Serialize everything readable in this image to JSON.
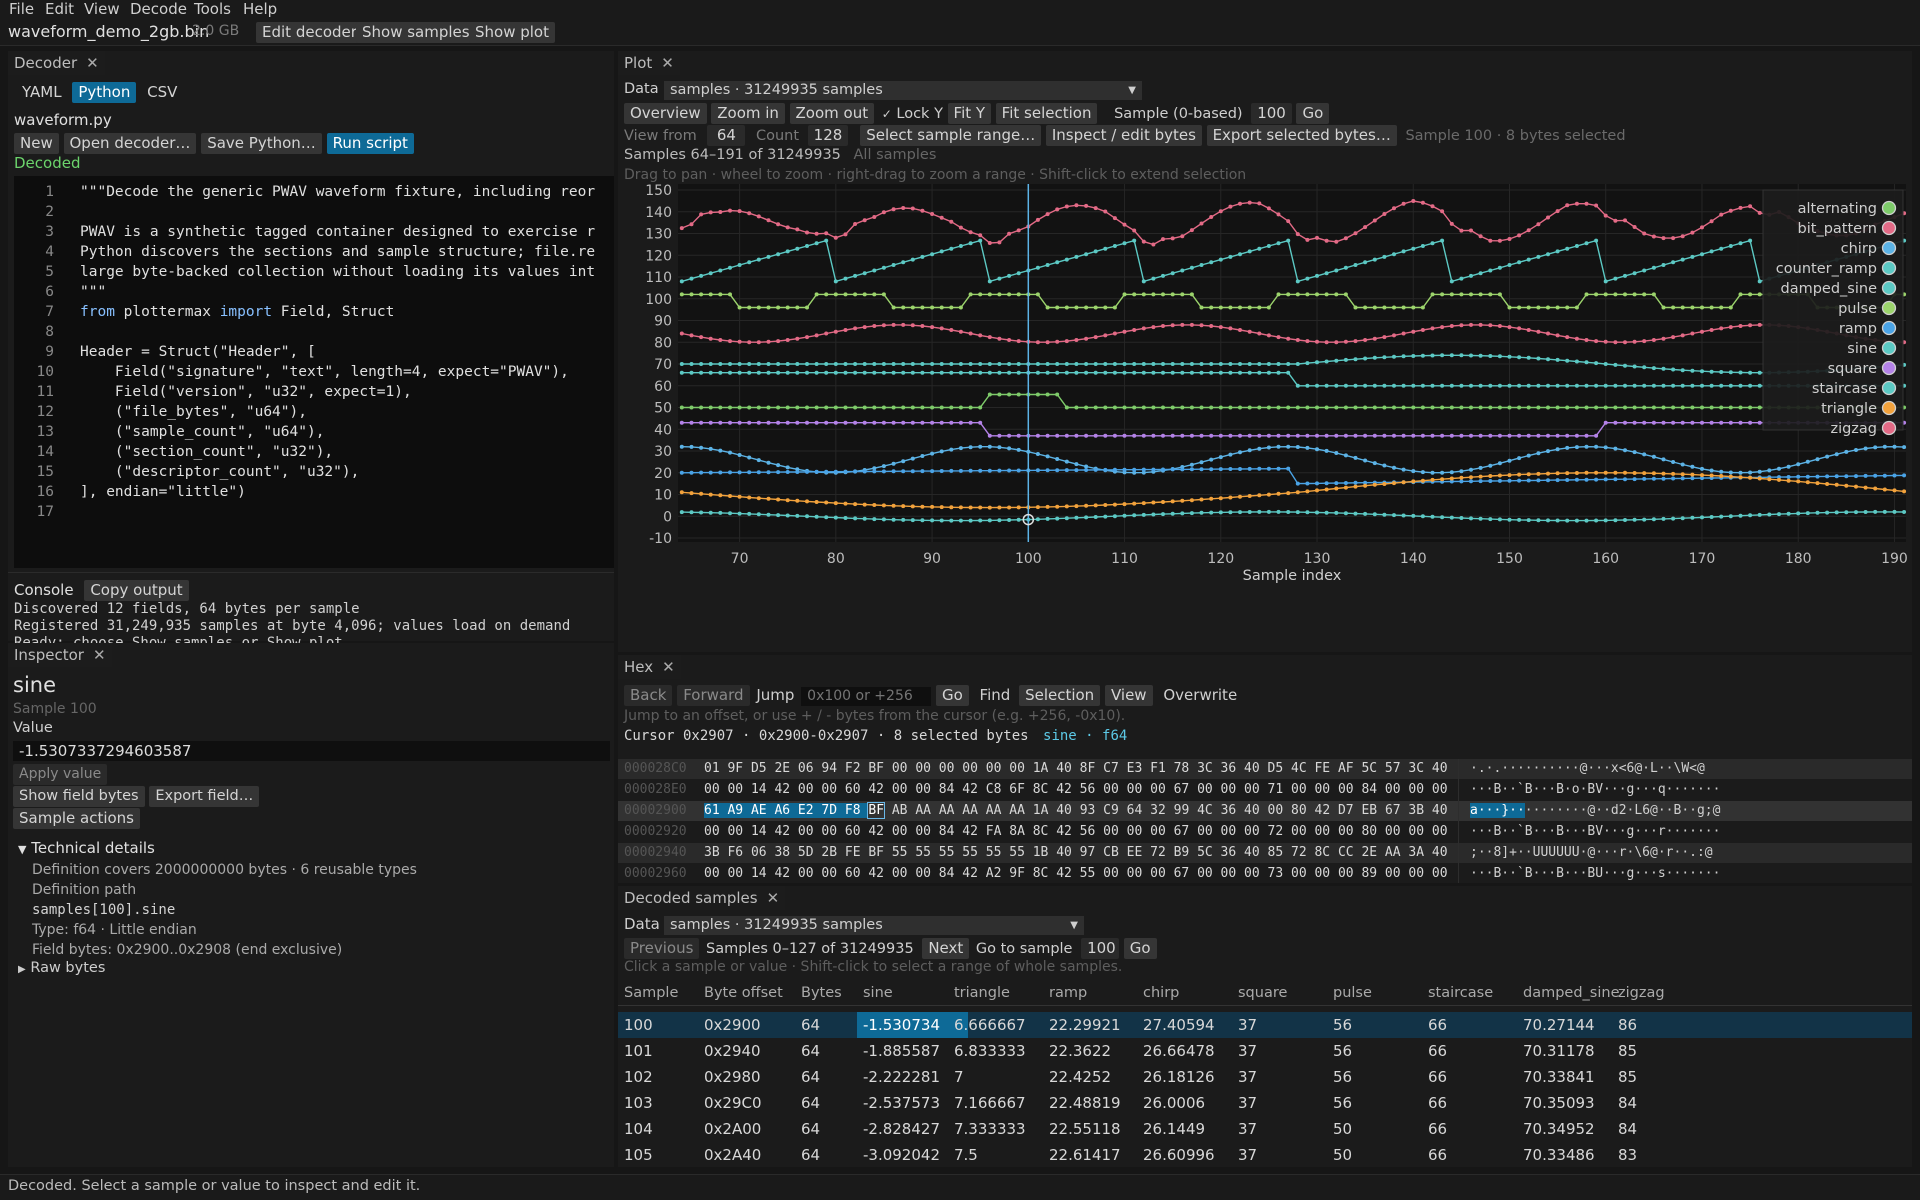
{
  "menu": [
    "File",
    "Edit",
    "View",
    "Decode",
    "Tools",
    "Help"
  ],
  "toolbar": {
    "filename": "waveform_demo_2gb.bin",
    "filesize": "2.0 GB",
    "edit_decoder": "Edit decoder",
    "show_samples": "Show samples",
    "show_plot": "Show plot"
  },
  "decoder": {
    "tab": "Decoder",
    "modes": [
      "YAML",
      "Python",
      "CSV"
    ],
    "active_mode": "Python",
    "file": "waveform.py",
    "buttons": {
      "new": "New",
      "open": "Open decoder…",
      "save": "Save Python…",
      "run": "Run script"
    },
    "status": "Decoded",
    "code": [
      "\"\"\"Decode the generic PWAV waveform fixture, including reor",
      "",
      "PWAV is a synthetic tagged container designed to exercise r",
      "Python discovers the sections and sample structure; file.re",
      "large byte-backed collection without loading its values int",
      "\"\"\"",
      "from plottermax import Field, Struct",
      "",
      "Header = Struct(\"Header\", [",
      "    Field(\"signature\", \"text\", length=4, expect=\"PWAV\"),",
      "    Field(\"version\", \"u32\", expect=1),",
      "    (\"file_bytes\", \"u64\"),",
      "    (\"sample_count\", \"u64\"),",
      "    (\"section_count\", \"u32\"),",
      "    (\"descriptor_count\", \"u32\"),",
      "], endian=\"little\")",
      ""
    ],
    "console_label": "Console",
    "copy_output": "Copy output",
    "console": [
      "Discovered 12 fields, 64 bytes per sample",
      "Registered 31,249,935 samples at byte 4,096; values load on demand",
      "Ready: choose Show samples or Show plot."
    ]
  },
  "inspector": {
    "tab": "Inspector",
    "name": "sine",
    "sample": "Sample 100",
    "value_label": "Value",
    "value": "-1.5307337294603587",
    "apply": "Apply value",
    "show_bytes": "Show field bytes",
    "export_field": "Export field…",
    "sample_actions": "Sample actions",
    "tech_title": "Technical details",
    "tech": {
      "covers": "Definition covers 2000000000 bytes · 6 reusable types",
      "path_label": "Definition path",
      "path": "samples[100].sine",
      "type": "Type: f64 · Little endian",
      "field_bytes": "Field bytes: 0x2900..0x2908 (end exclusive)"
    },
    "raw_bytes": "Raw bytes"
  },
  "plot": {
    "tab": "Plot",
    "data_label": "Data",
    "data_value": "samples · 31249935 samples",
    "overview": "Overview",
    "zoom_in": "Zoom in",
    "zoom_out": "Zoom out",
    "lock_y": "Lock Y",
    "fit_y": "Fit Y",
    "fit_selection": "Fit selection",
    "sample_label": "Sample (0-based)",
    "sample_value": "100",
    "go": "Go",
    "view_from": "View from",
    "view_from_value": "64",
    "count_label": "Count",
    "count_value": "128",
    "select_range": "Select sample range…",
    "inspect_bytes": "Inspect / edit bytes",
    "export_bytes": "Export selected bytes…",
    "selection_info": "Sample 100 · 8 bytes selected",
    "range_info": "Samples 64–191 of 31249935",
    "all_samples": "All samples",
    "hint": "Drag to pan · wheel to zoom · right-drag to zoom a range · Shift-click to extend selection"
  },
  "chart_data": {
    "type": "line",
    "xlabel": "Sample index",
    "ylabel": "",
    "xlim": [
      64,
      191
    ],
    "ylim": [
      -10,
      150
    ],
    "x_ticks": [
      70,
      80,
      90,
      100,
      110,
      120,
      130,
      140,
      150,
      160,
      170,
      180,
      190
    ],
    "y_ticks": [
      -10,
      0,
      10,
      20,
      30,
      40,
      50,
      60,
      70,
      80,
      90,
      100,
      110,
      120,
      130,
      140,
      150
    ],
    "cursor_x": 100,
    "legend": "top-right",
    "grid": true,
    "series": [
      {
        "name": "alternating",
        "color": "#7ecb6a"
      },
      {
        "name": "bit_pattern",
        "color": "#e36a86"
      },
      {
        "name": "chirp",
        "color": "#5cb3e6"
      },
      {
        "name": "counter_ramp",
        "color": "#5cc9c4"
      },
      {
        "name": "damped_sine",
        "color": "#5cc9c4"
      },
      {
        "name": "pulse",
        "color": "#9cd46c"
      },
      {
        "name": "ramp",
        "color": "#4aa3e6"
      },
      {
        "name": "sine",
        "color": "#5cc9c4"
      },
      {
        "name": "square",
        "color": "#b482e8"
      },
      {
        "name": "staircase",
        "color": "#5cc9c4"
      },
      {
        "name": "triangle",
        "color": "#f2a23c"
      },
      {
        "name": "zigzag",
        "color": "#e36a86"
      }
    ]
  },
  "hex": {
    "tab": "Hex",
    "back": "Back",
    "forward": "Forward",
    "jump": "Jump",
    "jump_placeholder": "0x100 or +256",
    "go": "Go",
    "find": "Find",
    "selection": "Selection",
    "view": "View",
    "overwrite": "Overwrite",
    "hint": "Jump to an offset, or use + / - bytes from the cursor (e.g. +256, -0x10).",
    "cursor": "Cursor 0x2907 · 0x2900-0x2907 · 8 selected bytes",
    "cursor_type": "sine · f64",
    "rows": [
      {
        "off": "000028C0",
        "bytes": "01 9F D5 2E 06 94 F2 BF 00 00 00 00 00 00 1A 40 8F C7 E3 F1 78 3C 36 40 D5 4C FE AF 5C 57 3C 40",
        "ascii": "·.·.··········@···x<6@·L··\\W<@"
      },
      {
        "off": "000028E0",
        "bytes": "00 00 14 42 00 00 60 42 00 00 84 42 C8 6F 8C 42 56 00 00 00 67 00 00 00 71 00 00 00 84 00 00 00",
        "ascii": "···B··`B···B·o·BV···g···q·······"
      },
      {
        "off": "00002900",
        "bytes_sel": "61 A9 AE A6 E2 7D F8",
        "bytes_cur": "BF",
        "bytes": "AB AA AA AA AA AA 1A 40 93 C9 64 32 99 4C 36 40 00 80 42 D7 EB 67 3B 40",
        "ascii_sel": "a···}··",
        "ascii": "········@··d2·L6@··B··g;@"
      },
      {
        "off": "00002920",
        "bytes": "00 00 14 42 00 00 60 42 00 00 84 42 FA 8A 8C 42 56 00 00 00 67 00 00 00 72 00 00 00 80 00 00 00",
        "ascii": "···B··`B···B···BV···g···r·······"
      },
      {
        "off": "00002940",
        "bytes": "3B F6 06 38 5D 2B FE BF 55 55 55 55 55 55 1B 40 97 CB EE 72 B9 5C 36 40 85 72 8C CC 2E AA 3A 40",
        "ascii": ";··8]+··UUUUUU·@···r·\\6@·r··.:@"
      },
      {
        "off": "00002960",
        "bytes": "00 00 14 42 00 00 60 42 00 00 84 42 A2 9F 8C 42 55 00 00 00 67 00 00 00 73 00 00 00 89 00 00 00",
        "ascii": "···B··`B···B···BU···g···s·······"
      }
    ]
  },
  "samples": {
    "tab": "Decoded samples",
    "data_label": "Data",
    "data_value": "samples · 31249935 samples",
    "previous": "Previous",
    "range": "Samples 0–127 of 31249935",
    "next": "Next",
    "go_to": "Go to sample",
    "go_to_value": "100",
    "go": "Go",
    "hint": "Click a sample or value · Shift-click to select a range of whole samples.",
    "columns": [
      "Sample",
      "Byte offset",
      "Bytes",
      "sine",
      "triangle",
      "ramp",
      "chirp",
      "square",
      "pulse",
      "staircase",
      "damped_sine",
      "zigzag"
    ],
    "rows": [
      [
        "100",
        "0x2900",
        "64",
        "-1.530734",
        "6.666667",
        "22.29921",
        "27.40594",
        "37",
        "56",
        "66",
        "70.27144",
        "86"
      ],
      [
        "101",
        "0x2940",
        "64",
        "-1.885587",
        "6.833333",
        "22.3622",
        "26.66478",
        "37",
        "56",
        "66",
        "70.31178",
        "85"
      ],
      [
        "102",
        "0x2980",
        "64",
        "-2.222281",
        "7",
        "22.4252",
        "26.18126",
        "37",
        "56",
        "66",
        "70.33841",
        "85"
      ],
      [
        "103",
        "0x29C0",
        "64",
        "-2.537573",
        "7.166667",
        "22.48819",
        "26.0006",
        "37",
        "56",
        "66",
        "70.35093",
        "84"
      ],
      [
        "104",
        "0x2A00",
        "64",
        "-2.828427",
        "7.333333",
        "22.55118",
        "26.1449",
        "37",
        "50",
        "66",
        "70.34952",
        "84"
      ],
      [
        "105",
        "0x2A40",
        "64",
        "-3.092042",
        "7.5",
        "22.61417",
        "26.60996",
        "37",
        "50",
        "66",
        "70.33486",
        "83"
      ]
    ]
  },
  "statusbar": "Decoded. Select a sample or value to inspect and edit it."
}
